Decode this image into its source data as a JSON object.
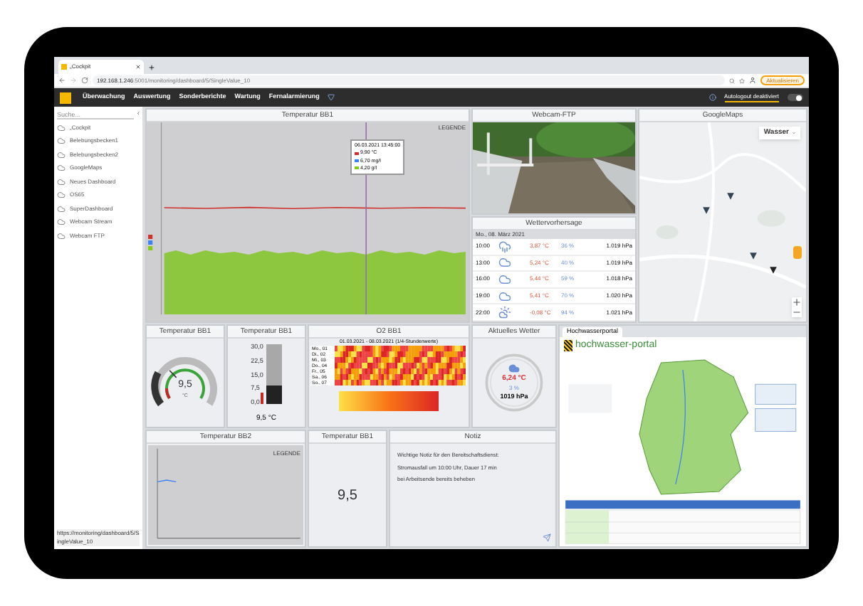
{
  "browser": {
    "tab": "„Cockpit",
    "url_host": "192.168.1.246",
    "url_path": ":5001/monitoring/dashboard/5/SingleValue_10",
    "refresh": "Aktualisieren"
  },
  "nav": {
    "items": [
      "Überwachung",
      "Auswertung",
      "Sonderberichte",
      "Wartung",
      "Fernalarmierung"
    ],
    "autologout": "Autologout deaktiviert",
    "switch_on": true
  },
  "sidebar": {
    "search_placeholder": "Suche...",
    "collapse": "‹",
    "items": [
      "„Cockpit",
      "Belebungsbecken1",
      "Belebungsbecken2",
      "GoogleMaps",
      "Neues Dashboard",
      "OS65",
      "SuperDashboard",
      "Webcam Stream",
      "Webcam FTP"
    ]
  },
  "status_bar": "https://monitoring/dashboard/5/SingleValue_10",
  "temp_chart": {
    "title": "Temperatur BB1",
    "legend": "LEGENDE",
    "tooltip": {
      "time": "06.03.2021 13:45:00",
      "rows": [
        {
          "text": "9,90 °C",
          "color": "#d0312d"
        },
        {
          "text": "6,70 mg/l",
          "color": "#3b82f6"
        },
        {
          "text": "4,20 g/l",
          "color": "#84cc16"
        }
      ]
    }
  },
  "webcam": {
    "title": "Webcam-FTP"
  },
  "weather": {
    "title": "Wettervorhersage",
    "date": "Mo., 08. März 2021",
    "rows": [
      {
        "time": "10:00",
        "kind": "rain",
        "temp": "3,87 °C",
        "humidity": "36 %",
        "pressure": "1.019 hPa"
      },
      {
        "time": "13:00",
        "kind": "cloud",
        "temp": "5,24 °C",
        "humidity": "40 %",
        "pressure": "1.019 hPa"
      },
      {
        "time": "16:00",
        "kind": "cloud",
        "temp": "5,44 °C",
        "humidity": "59 %",
        "pressure": "1.018 hPa"
      },
      {
        "time": "19:00",
        "kind": "cloud",
        "temp": "5,41 °C",
        "humidity": "70 %",
        "pressure": "1.020 hPa"
      },
      {
        "time": "22:00",
        "kind": "sun-cloud",
        "temp": "-0,08 °C",
        "humidity": "94 %",
        "pressure": "1.021 hPa"
      }
    ]
  },
  "maps": {
    "title": "GoogleMaps",
    "layer": "Wasser"
  },
  "gauge": {
    "title": "Temperatur BB1",
    "value": "9,5",
    "unit": "°C",
    "level": 0.32
  },
  "thermometer": {
    "title": "Temperatur BB1",
    "ticks": [
      "30,0",
      "22,5",
      "15,0",
      "7,5",
      "0,0"
    ],
    "level": 0.32,
    "reading": "9,5 °C"
  },
  "heatmap": {
    "title": "O2 BB1",
    "subtitle": "01.03.2021 - 08.03.2021 (1/4-Stundenwerte)",
    "rows": [
      "Mo., 01",
      "Di., 02",
      "Mi., 03",
      "Do., 04",
      "Fr., 05",
      "Sa., 06",
      "So., 07"
    ]
  },
  "current_weather": {
    "title": "Aktuelles Wetter",
    "temp": "6,24 °C",
    "humidity": "3 %",
    "pressure": "1019 hPa"
  },
  "portal": {
    "tab": "Hochwasserportal",
    "logo": "hochwasser-portal"
  },
  "temp_chart_2": {
    "title": "Temperatur BB2",
    "legend": "LEGENDE"
  },
  "single_value": {
    "title": "Temperatur BB1",
    "value": "9,5"
  },
  "note": {
    "title": "Notiz",
    "lines": [
      "Wichtige Notiz für den Bereitschaftsdienst:",
      "Stromausfall um 10:00 Uhr, Dauer 17 min",
      "bei Arbeitsende bereits beheben"
    ]
  }
}
